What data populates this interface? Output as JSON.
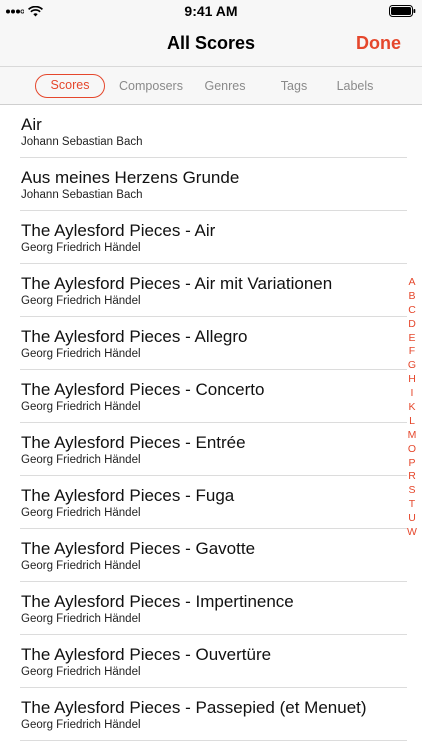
{
  "status_bar": {
    "time": "9:41 AM"
  },
  "nav": {
    "title": "All Scores",
    "done_label": "Done"
  },
  "segments": [
    {
      "label": "Scores",
      "selected": true
    },
    {
      "label": "Composers",
      "selected": false
    },
    {
      "label": "Genres",
      "selected": false
    },
    {
      "label": "Tags",
      "selected": false
    },
    {
      "label": "Labels",
      "selected": false
    }
  ],
  "scores": [
    {
      "title": "Air",
      "composer": "Johann Sebastian Bach"
    },
    {
      "title": "Aus meines Herzens Grunde",
      "composer": "Johann Sebastian Bach"
    },
    {
      "title": "The Aylesford Pieces - Air",
      "composer": "Georg Friedrich Händel"
    },
    {
      "title": "The Aylesford Pieces - Air mit Variationen",
      "composer": "Georg Friedrich Händel"
    },
    {
      "title": "The Aylesford Pieces - Allegro",
      "composer": "Georg Friedrich Händel"
    },
    {
      "title": "The Aylesford Pieces - Concerto",
      "composer": "Georg Friedrich Händel"
    },
    {
      "title": "The Aylesford Pieces - Entrée",
      "composer": "Georg Friedrich Händel"
    },
    {
      "title": "The Aylesford Pieces - Fuga",
      "composer": "Georg Friedrich Händel"
    },
    {
      "title": "The Aylesford Pieces - Gavotte",
      "composer": "Georg Friedrich Händel"
    },
    {
      "title": "The Aylesford Pieces - Impertinence",
      "composer": "Georg Friedrich Händel"
    },
    {
      "title": "The Aylesford Pieces - Ouvertüre",
      "composer": "Georg Friedrich Händel"
    },
    {
      "title": "The Aylesford Pieces - Passepied (et Menuet)",
      "composer": "Georg Friedrich Händel"
    }
  ],
  "index_letters": [
    "A",
    "B",
    "C",
    "D",
    "E",
    "F",
    "G",
    "H",
    "I",
    "K",
    "L",
    "M",
    "O",
    "P",
    "R",
    "S",
    "T",
    "U",
    "W"
  ],
  "colors": {
    "accent": "#e5472c",
    "bar_background": "#f7f7f7",
    "separator": "#dcdcdc"
  }
}
